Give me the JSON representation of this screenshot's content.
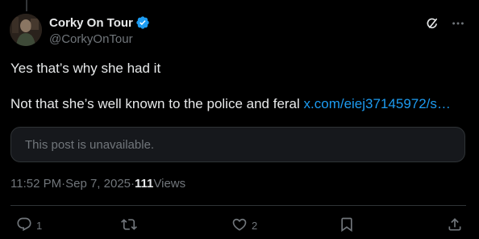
{
  "author": {
    "display_name": "Corky On Tour",
    "handle": "@CorkyOnTour",
    "verified": true,
    "verified_color": "#1d9bf0"
  },
  "post": {
    "line1": "Yes that’s why she had it",
    "line2_text": "Not that she’s well known to the police and feral ",
    "line2_link": "x.com/eiej37145972/s…"
  },
  "quote": {
    "unavailable_text": "This post is unavailable."
  },
  "meta": {
    "time": "11:52 PM",
    "separator1": " · ",
    "date": "Sep 7, 2025",
    "separator2": " · ",
    "views_count": "111",
    "views_label": " Views"
  },
  "actions": {
    "reply_count": "1",
    "repost_count": "",
    "like_count": "2"
  },
  "icons": {
    "top_right": [
      "grok-icon",
      "more-icon"
    ],
    "action_bar": [
      "reply-icon",
      "repost-icon",
      "like-icon",
      "bookmark-icon",
      "share-icon"
    ]
  },
  "colors": {
    "background": "#000000",
    "text_primary": "#e7e9ea",
    "text_secondary": "#71767b",
    "link": "#1d9bf0",
    "border": "#2f3336"
  }
}
